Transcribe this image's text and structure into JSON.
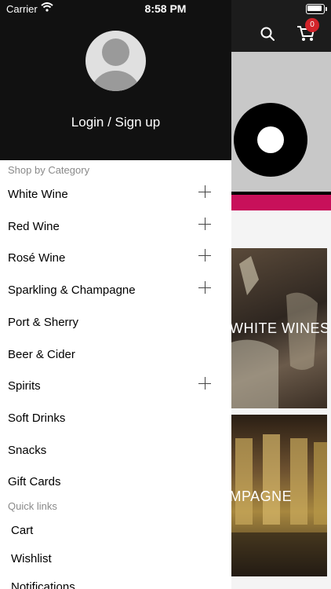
{
  "status_bar": {
    "carrier": "Carrier",
    "time": "8:58 PM"
  },
  "header": {
    "cart_count": "0"
  },
  "tiles": [
    {
      "label": "WHITE WINES"
    },
    {
      "label": "CHAMPAGNE"
    }
  ],
  "drawer": {
    "login_label": "Login / Sign up",
    "category_title": "Shop by Category",
    "categories": [
      {
        "label": "White Wine",
        "expandable": true
      },
      {
        "label": "Red Wine",
        "expandable": true
      },
      {
        "label": "Rosé Wine",
        "expandable": true
      },
      {
        "label": "Sparkling & Champagne",
        "expandable": true
      },
      {
        "label": "Port & Sherry",
        "expandable": false
      },
      {
        "label": "Beer & Cider",
        "expandable": false
      },
      {
        "label": "Spirits",
        "expandable": true
      },
      {
        "label": "Soft Drinks",
        "expandable": false
      },
      {
        "label": "Snacks",
        "expandable": false
      },
      {
        "label": "Gift Cards",
        "expandable": false
      }
    ],
    "quick_links_title": "Quick links",
    "quick_links": [
      {
        "label": "Cart"
      },
      {
        "label": "Wishlist"
      },
      {
        "label": "Notifications"
      }
    ]
  },
  "colors": {
    "accent_pink": "#c8105a",
    "badge_red": "#d2232a",
    "drawer_header": "#111111"
  }
}
